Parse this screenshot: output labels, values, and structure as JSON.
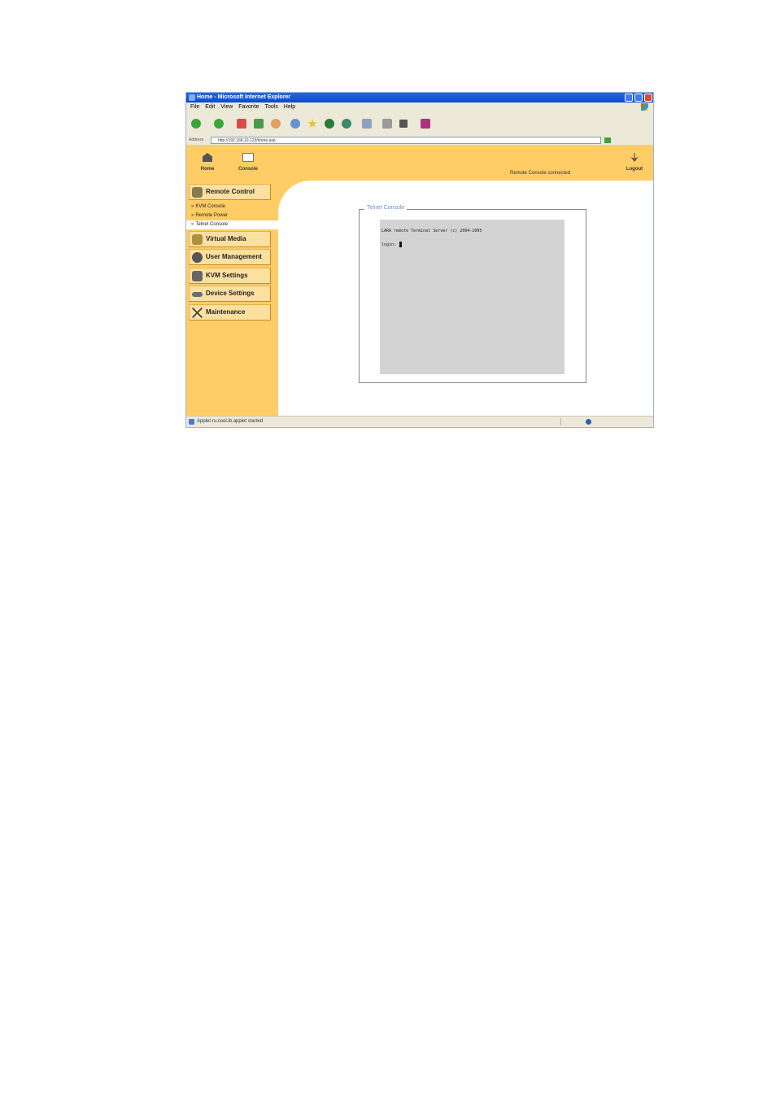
{
  "window": {
    "title": "Home - Microsoft Internet Explorer"
  },
  "menubar": {
    "items": [
      "File",
      "Edit",
      "View",
      "Favorite",
      "Tools",
      "Help"
    ]
  },
  "toolbar": {
    "icons": [
      "back-icon",
      "forward-icon",
      "stop-icon",
      "refresh-icon",
      "home-icon",
      "search-icon",
      "favorites-icon",
      "media-icon",
      "history-icon",
      "mail-icon",
      "print-icon",
      "edit-icon",
      "messenger-icon"
    ]
  },
  "address": {
    "label": "Address",
    "url": "http://192.168.10.123/home.asp"
  },
  "topnav": {
    "home_label": "Home",
    "console_label": "Console",
    "status": "Remote Console connected",
    "logout_label": "Logout"
  },
  "sidebar": {
    "remote_control": "Remote Control",
    "sub_items": [
      "KVM Console",
      "Remote Power",
      "Telnet Console"
    ],
    "virtual_media": "Virtual Media",
    "user_management": "User Management",
    "kvm_settings": "KVM Settings",
    "device_settings": "Device Settings",
    "maintenance": "Maintenance"
  },
  "content": {
    "legend": "Telnet Console",
    "terminal_line1": "LARA remote Terminal Server (c) 2004-2005",
    "terminal_line2": "login:"
  },
  "statusbar": {
    "text": "Applet ru.cool.ib.applet started"
  },
  "colors": {
    "accent": "#ffcc66",
    "legend": "#6b8ed6",
    "terminal_bg": "#d3d3d3"
  }
}
